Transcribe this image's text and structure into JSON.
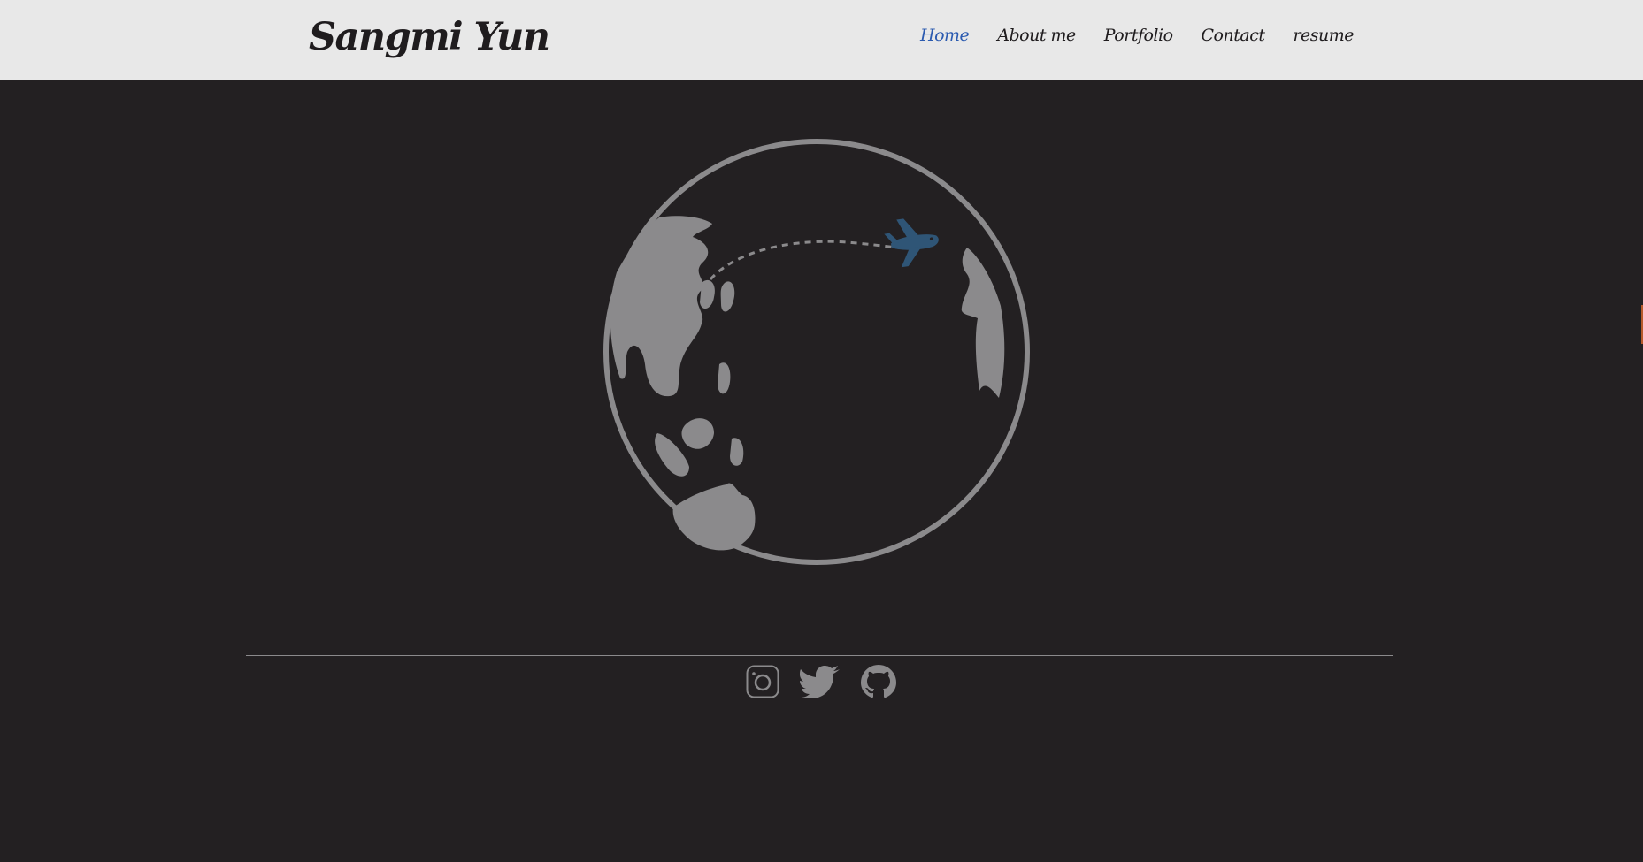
{
  "site": {
    "brand": "Sangmi Yun"
  },
  "nav": {
    "items": [
      {
        "label": "Home",
        "active": true
      },
      {
        "label": "About me",
        "active": false
      },
      {
        "label": "Portfolio",
        "active": false
      },
      {
        "label": "Contact",
        "active": false
      },
      {
        "label": "resume",
        "active": false
      }
    ]
  },
  "hero": {
    "illustration": "globe-with-airplane",
    "colors": {
      "globe": "#8b8a8c",
      "airplane": "#2f5576",
      "background": "#232022"
    }
  },
  "footer": {
    "social": [
      {
        "icon": "instagram-icon"
      },
      {
        "icon": "twitter-icon"
      },
      {
        "icon": "github-icon"
      }
    ]
  },
  "colors": {
    "navbar": "#e8e8e8",
    "text": "#1f1c1e",
    "accent": "#2c5bb0",
    "page": "#232022"
  }
}
